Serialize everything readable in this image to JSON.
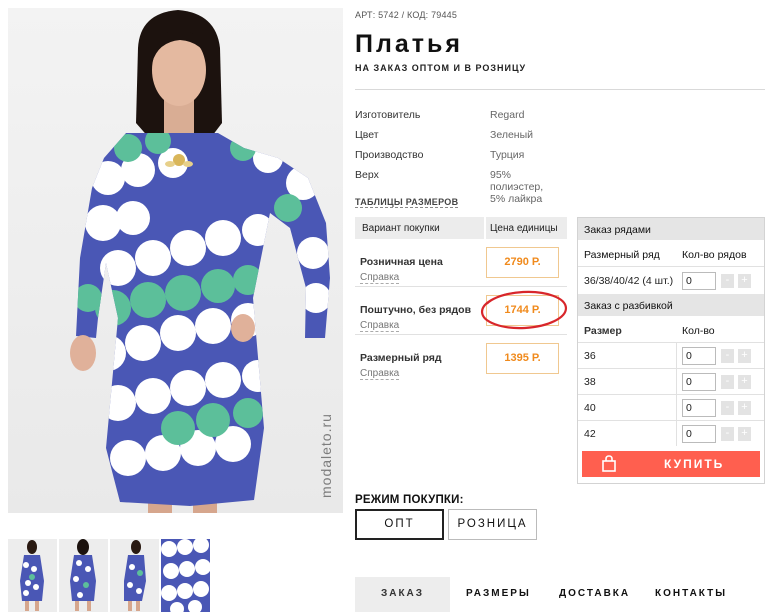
{
  "product": {
    "sku_line": "АРТ: 5742 / КОД: 79445",
    "title": "Платья",
    "subtitle": "НА ЗАКАЗ ОПТОМ И В РОЗНИЦУ",
    "watermark": "modaleto.ru"
  },
  "specs": [
    {
      "key": "Изготовитель",
      "value": "Regard"
    },
    {
      "key": "Цвет",
      "value": "Зеленый"
    },
    {
      "key": "Производство",
      "value": "Турция"
    },
    {
      "key": "Верх",
      "value": "95% полиэстер, 5% лайкра"
    }
  ],
  "size_tables_link": "ТАБЛИЦЫ РАЗМЕРОВ",
  "price_table": {
    "col_variant": "Вариант покупки",
    "col_price": "Цена единицы",
    "rows": [
      {
        "name": "Розничная цена",
        "link": "Справка",
        "price": "2790 Р."
      },
      {
        "name": "Поштучно, без рядов",
        "link": "Справка",
        "price": "1744 Р."
      },
      {
        "name": "Размерный ряд",
        "link": "Справка",
        "price": "1395 Р."
      }
    ]
  },
  "order": {
    "rows_header": "Заказ рядами",
    "rows_col_size": "Размерный ряд",
    "rows_col_qty": "Кол-во рядов",
    "row_set": {
      "label": "36/38/40/42 (4 шт.)",
      "qty": "0"
    },
    "split_header": "Заказ с разбивкой",
    "split_col_size": "Размер",
    "split_col_qty": "Кол-во",
    "sizes": [
      {
        "size": "36",
        "qty": "0"
      },
      {
        "size": "38",
        "qty": "0"
      },
      {
        "size": "40",
        "qty": "0"
      },
      {
        "size": "42",
        "qty": "0"
      }
    ],
    "minus": "-",
    "plus": "+",
    "buy_label": "КУПИТЬ"
  },
  "mode": {
    "label": "РЕЖИМ ПОКУПКИ:",
    "opt": "ОПТ",
    "retail": "РОЗНИЦА",
    "selected": "ОПТ"
  },
  "tabs": [
    {
      "label": "ЗАКАЗ",
      "active": true
    },
    {
      "label": "РАЗМЕРЫ",
      "active": false
    },
    {
      "label": "ДОСТАВКА",
      "active": false
    },
    {
      "label": "КОНТАКТЫ",
      "active": false
    }
  ],
  "colors": {
    "accent_orange": "#f08a1c",
    "buy_button": "#ff5f4f",
    "highlight_circle": "#d8262b",
    "dress_blue": "#4a57b5",
    "dress_green": "#5cbf9a"
  }
}
